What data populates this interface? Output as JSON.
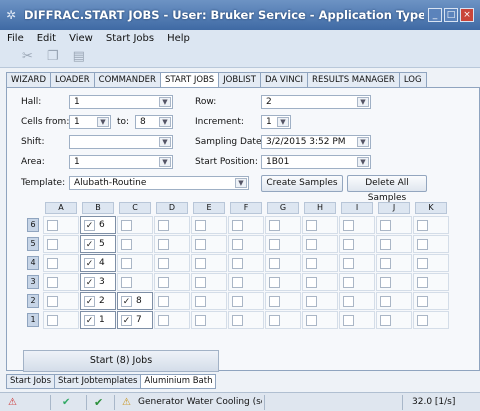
{
  "window": {
    "title": "DIFFRAC.START JOBS - User: Bruker Service - Application Type: Powder Diffraction...",
    "minimize": "_",
    "maximize": "□",
    "close": "×"
  },
  "menu": [
    "File",
    "Edit",
    "View",
    "Start Jobs",
    "Help"
  ],
  "toolbar": {
    "icons": [
      "cut-icon",
      "copy-icon",
      "paste-icon"
    ]
  },
  "tabs": [
    {
      "label": "WIZARD"
    },
    {
      "label": "LOADER"
    },
    {
      "label": "COMMANDER"
    },
    {
      "label": "START JOBS",
      "active": true
    },
    {
      "label": "JOBLIST"
    },
    {
      "label": "DA VINCI"
    },
    {
      "label": "RESULTS MANAGER"
    },
    {
      "label": "LOG"
    }
  ],
  "form": {
    "hall_label": "Hall:",
    "hall_value": "1",
    "row_label": "Row:",
    "row_value": "2",
    "cells_from_label": "Cells from:",
    "cells_from_value": "1",
    "to_label": "to:",
    "to_value": "8",
    "increment_label": "Increment:",
    "increment_value": "1",
    "shift_label": "Shift:",
    "shift_value": "",
    "sampling_date_label": "Sampling Date:",
    "sampling_date_value": "3/2/2015 3:52 PM",
    "area_label": "Area:",
    "area_value": "1",
    "start_position_label": "Start Position:",
    "start_position_value": "1B01",
    "template_label": "Template:",
    "template_value": "Alubath-Routine",
    "create_samples": "Create Samples",
    "delete_all_samples": "Delete All Samples"
  },
  "grid": {
    "columns": [
      "A",
      "B",
      "C",
      "D",
      "E",
      "F",
      "G",
      "H",
      "I",
      "J",
      "K"
    ],
    "rows": [
      "6",
      "5",
      "4",
      "3",
      "2",
      "1"
    ],
    "checked": [
      {
        "row": "6",
        "col": "B",
        "num": "6"
      },
      {
        "row": "5",
        "col": "B",
        "num": "5"
      },
      {
        "row": "4",
        "col": "B",
        "num": "4"
      },
      {
        "row": "3",
        "col": "B",
        "num": "3"
      },
      {
        "row": "2",
        "col": "B",
        "num": "2"
      },
      {
        "row": "2",
        "col": "C",
        "num": "8"
      },
      {
        "row": "1",
        "col": "B",
        "num": "1"
      },
      {
        "row": "1",
        "col": "C",
        "num": "7"
      }
    ],
    "check_mark": "✓"
  },
  "start_button": "Start (8) Jobs",
  "bottom_tabs": [
    {
      "label": "Start Jobs"
    },
    {
      "label": "Start Jobtemplates"
    },
    {
      "label": "Aluminium Bath",
      "active": true
    }
  ],
  "status": {
    "warning": "Generator Water Cooling (se",
    "rate": "32.0 [1/s]"
  }
}
